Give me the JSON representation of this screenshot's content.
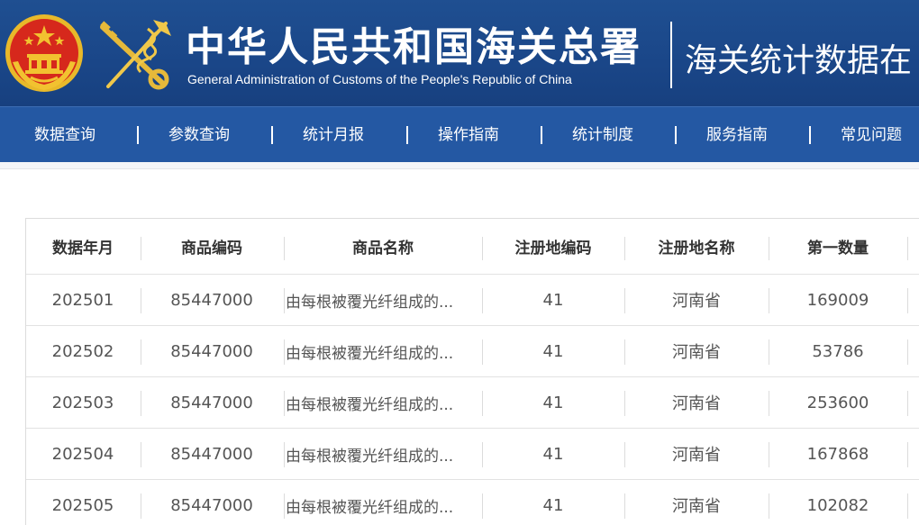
{
  "header": {
    "title_cn": "中华人民共和国海关总署",
    "title_en": "General Administration of Customs of the People's Republic of China",
    "subtitle": "海关统计数据在"
  },
  "nav": {
    "items": [
      "数据查询",
      "参数查询",
      "统计月报",
      "操作指南",
      "统计制度",
      "服务指南",
      "常见问题"
    ],
    "separator": "|"
  },
  "table": {
    "columns": [
      "数据年月",
      "商品编码",
      "商品名称",
      "注册地编码",
      "注册地名称",
      "第一数量"
    ],
    "rows": [
      [
        "202501",
        "85447000",
        "由每根被覆光纤组成的...",
        "41",
        "河南省",
        "169009"
      ],
      [
        "202502",
        "85447000",
        "由每根被覆光纤组成的...",
        "41",
        "河南省",
        "53786"
      ],
      [
        "202503",
        "85447000",
        "由每根被覆光纤组成的...",
        "41",
        "河南省",
        "253600"
      ],
      [
        "202504",
        "85447000",
        "由每根被覆光纤组成的...",
        "41",
        "河南省",
        "167868"
      ],
      [
        "202505",
        "85447000",
        "由每根被覆光纤组成的...",
        "41",
        "河南省",
        "102082"
      ]
    ]
  },
  "colors": {
    "header_bg": "#1a4688",
    "nav_bg": "#2458a3",
    "emblem_red": "#d6281c",
    "emblem_gold": "#f2c230"
  },
  "icons": {
    "emblem": "national-emblem-icon",
    "customs_logo": "customs-key-caduceus-icon"
  }
}
